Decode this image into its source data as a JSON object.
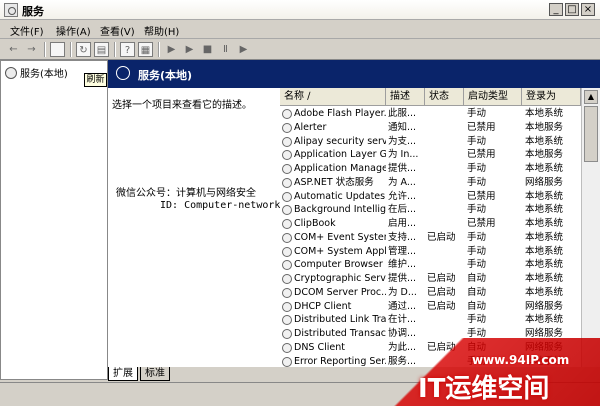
{
  "window": {
    "title": "服务"
  },
  "menu": [
    "文件(F)",
    "操作(A)",
    "查看(V)",
    "帮助(H)"
  ],
  "toolbar": {
    "icons": [
      "back-icon",
      "forward-icon",
      "show-hide-tree-icon",
      "refresh-icon",
      "export-icon",
      "help-icon",
      "properties-icon",
      "play-icon",
      "play-alt-icon",
      "stop-icon",
      "pause-icon",
      "restart-icon"
    ]
  },
  "tree": {
    "node": "服务(本地)",
    "tooltip": "刷新"
  },
  "header": {
    "title": "服务(本地)"
  },
  "desc": {
    "text": "选择一个项目来查看它的描述。",
    "wechat": "微信公众号：计算机与网络安全",
    "id": "ID: Computer-network"
  },
  "table": {
    "columns": [
      "名称",
      "描述",
      "状态",
      "启动类型",
      "登录为"
    ],
    "rows": [
      [
        "Adobe Flash Player...",
        "此服...",
        "",
        "手动",
        "本地系统"
      ],
      [
        "Alerter",
        "通知...",
        "",
        "已禁用",
        "本地服务"
      ],
      [
        "Alipay security serv...",
        "为支...",
        "",
        "手动",
        "本地系统"
      ],
      [
        "Application Layer G...",
        "为 In...",
        "",
        "已禁用",
        "本地服务"
      ],
      [
        "Application Manage...",
        "提供...",
        "",
        "手动",
        "本地系统"
      ],
      [
        "ASP.NET 状态服务",
        "为 A...",
        "",
        "手动",
        "网络服务"
      ],
      [
        "Automatic Updates",
        "允许...",
        "",
        "已禁用",
        "本地系统"
      ],
      [
        "Background Intellig...",
        "在后...",
        "",
        "手动",
        "本地系统"
      ],
      [
        "ClipBook",
        "启用...",
        "",
        "已禁用",
        "本地系统"
      ],
      [
        "COM+ Event System",
        "支持...",
        "已启动",
        "手动",
        "本地系统"
      ],
      [
        "COM+ System Appli...",
        "管理...",
        "",
        "手动",
        "本地系统"
      ],
      [
        "Computer Browser",
        "维护...",
        "",
        "手动",
        "本地系统"
      ],
      [
        "Cryptographic Serv...",
        "提供...",
        "已启动",
        "自动",
        "本地系统"
      ],
      [
        "DCOM Server Proc...",
        "为 D...",
        "已启动",
        "自动",
        "本地系统"
      ],
      [
        "DHCP Client",
        "通过...",
        "已启动",
        "自动",
        "网络服务"
      ],
      [
        "Distributed Link Tra...",
        "在计...",
        "",
        "手动",
        "本地系统"
      ],
      [
        "Distributed Transac...",
        "协调...",
        "",
        "手动",
        "网络服务"
      ],
      [
        "DNS Client",
        "为此...",
        "已启动",
        "自动",
        "网络服务"
      ],
      [
        "Error Reporting Ser...",
        "服务...",
        "",
        "手动",
        "本地系统"
      ]
    ]
  },
  "tabs": [
    "扩展",
    "标准"
  ],
  "watermark": {
    "url": "www.94IP.com",
    "text": "IT运维空间"
  },
  "colors": {
    "header": "#0a246a",
    "watermark": "#d40000"
  }
}
